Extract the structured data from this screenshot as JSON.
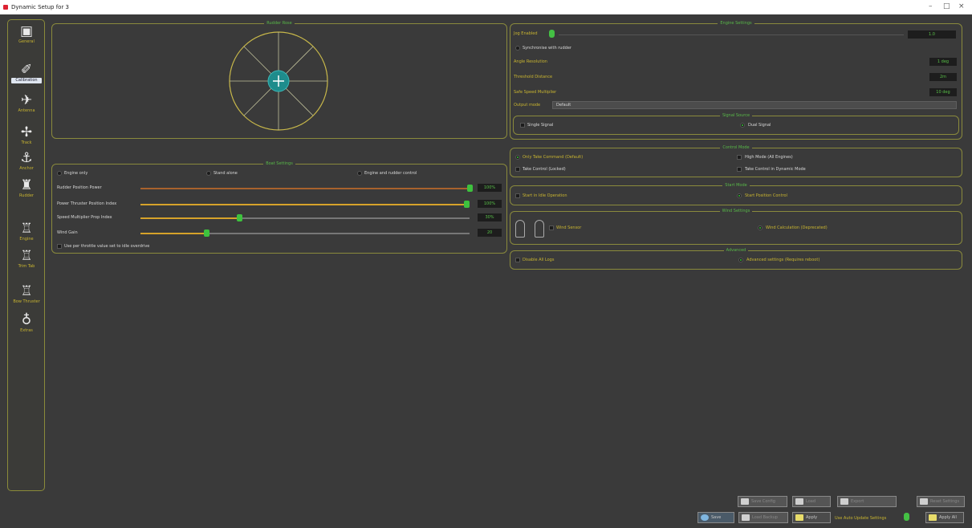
{
  "window": {
    "title": "Dynamic Setup for 3"
  },
  "sidebar": {
    "items": [
      {
        "label": "General",
        "icon": "radio-icon"
      },
      {
        "label": "Calibration",
        "icon": "satellite-icon"
      },
      {
        "label": "Antenna",
        "icon": "satellite-dish-icon"
      },
      {
        "label": "Track",
        "icon": "plane-icon"
      },
      {
        "label": "Anchor",
        "icon": "anchor-icon"
      },
      {
        "label": "Rudder",
        "icon": "motor-icon"
      },
      {
        "label": "Engine",
        "icon": "outboard-icon"
      },
      {
        "label": "Trim Tab",
        "icon": "outboard-icon"
      },
      {
        "label": "Bow Thruster",
        "icon": "thruster-icon"
      },
      {
        "label": "Extras",
        "icon": "money-bag-icon"
      }
    ]
  },
  "compass_panel": {
    "title": "Rudder Rose"
  },
  "sliders_panel": {
    "title": "Boat Settings",
    "radios": [
      "Engine only",
      "Stand alone",
      "Engine and rudder control"
    ],
    "sliders": [
      {
        "label": "Rudder Position Power",
        "value": "100%",
        "fraction": 1.0,
        "color": "#a8622c"
      },
      {
        "label": "Power Thruster Position Index",
        "value": "100%",
        "fraction": 0.99,
        "color": "#d6a22a"
      },
      {
        "label": "Speed Multiplier Prop Index",
        "value": "30%",
        "fraction": 0.3,
        "color": "#d6a22a"
      },
      {
        "label": "Wind Gain",
        "value": "20",
        "fraction": 0.2,
        "color": "#d6a22a"
      }
    ],
    "checkbox_label": "Use per throttle value set to idle overdrive"
  },
  "right_top": {
    "title": "Engine Settings",
    "jog_label": "Jog Enabled",
    "jog_value": "1.0",
    "sync_label": "Synchronise with rudder",
    "rows": [
      {
        "label": "Angle Resolution",
        "value": "1 deg"
      },
      {
        "label": "Threshold Distance",
        "value": "2m"
      },
      {
        "label": "Safe Speed Multiplier",
        "value": "10 deg"
      }
    ],
    "select_label": "Output mode",
    "select_value": "Default",
    "gps_title": "Signal Source",
    "gps_single": "Single Signal",
    "gps_dual": "Dual Signal"
  },
  "control_mode": {
    "title": "Control Mode",
    "opt1": "Only Take Command (Default)",
    "opt2": "Take Control (Locked)",
    "opt3": "High Mode (All Engines)",
    "opt4": "Take Control in Dynamic Mode"
  },
  "start_mode": {
    "title": "Start Mode",
    "opt1": "Start in Idle Operation",
    "opt2": "Start Position Control"
  },
  "wind_panel": {
    "title": "Wind Settings",
    "opt1": "Wind Sensor",
    "opt2": "Wind Calculation (Deprecated)"
  },
  "advanced": {
    "title": "Advanced",
    "opt1": "Disable All Logs",
    "opt2": "Advanced settings (Requires reboot)"
  },
  "bottom": {
    "row1": [
      "Save Config",
      "Load",
      "Export",
      "Reset Settings"
    ],
    "row2": [
      "Save",
      "Load Backup",
      "Apply",
      "Apply All"
    ],
    "toggle_label": "Use Auto Update Settings"
  }
}
